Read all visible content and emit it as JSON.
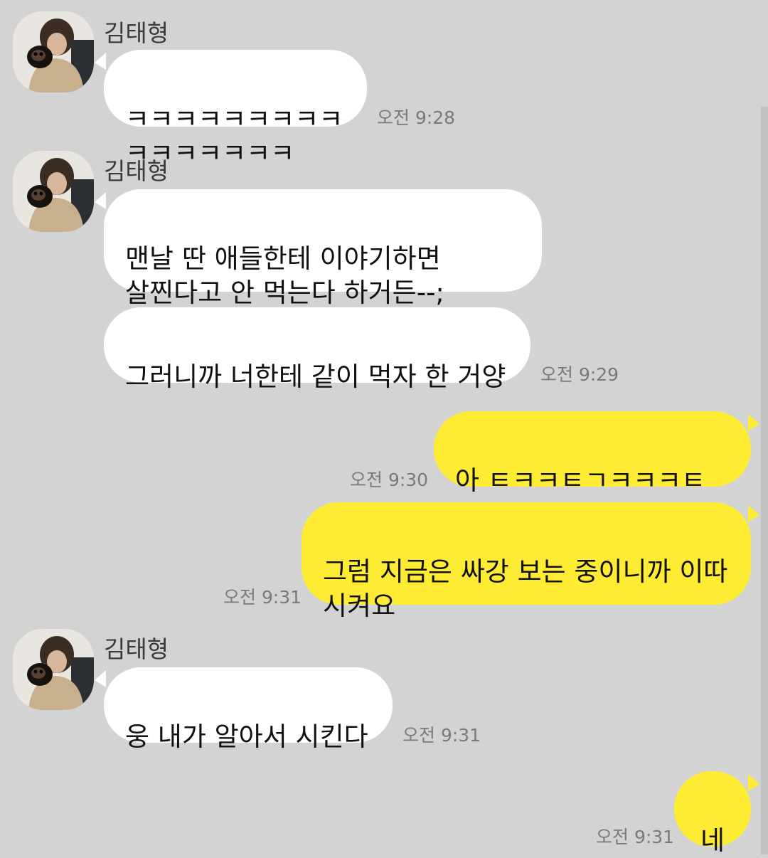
{
  "sender": {
    "name": "김태형"
  },
  "messages": [
    {
      "from": "other",
      "show_profile": true,
      "text": "ㅋㅋㅋㅋㅋㅋㅋㅋㅋㅋㅋㅋㅋㅋㅋㅋ",
      "time": "오전 9:28"
    },
    {
      "from": "other",
      "show_profile": true,
      "text": "맨날 딴 애들한테 이야기하면\n살찐다고 안 먹는다 하거든--;",
      "time": ""
    },
    {
      "from": "other",
      "show_profile": false,
      "text": "그러니까 너한테 같이 먹자 한 거양",
      "time": "오전 9:29"
    },
    {
      "from": "me",
      "text": "아 ㅌㅋㅋㅌㄱㅋㅋㅋㅌㅋㅋㅌㅋㅋㅋ",
      "time": "오전 9:30"
    },
    {
      "from": "me",
      "text": "그럼 지금은 싸강 보는 중이니까 이따\n시켜요",
      "time": "오전 9:31"
    },
    {
      "from": "other",
      "show_profile": true,
      "text": "웅 내가 알아서 시킨다",
      "time": "오전 9:31"
    },
    {
      "from": "me",
      "text": "네",
      "time": "오전 9:31"
    }
  ],
  "colors": {
    "background": "#d3d3d3",
    "received_bubble": "#ffffff",
    "sent_bubble": "#feec34",
    "time_text": "#7a7a7a"
  }
}
